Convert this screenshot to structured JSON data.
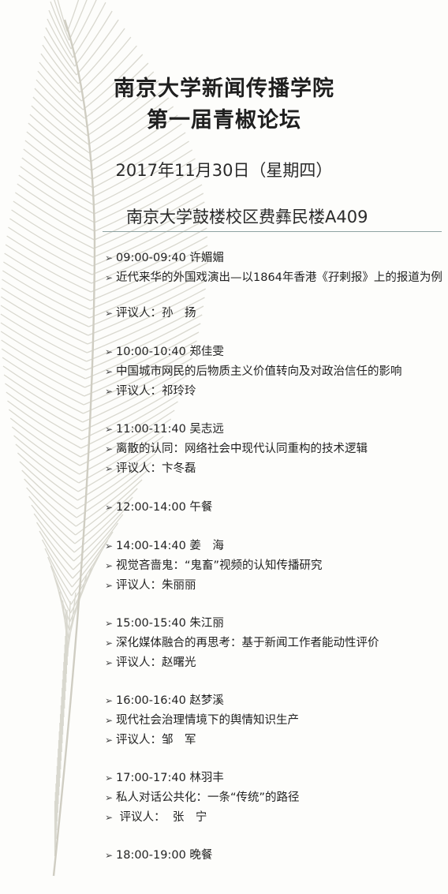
{
  "title": {
    "line1": "南京大学新闻传播学院",
    "line2": "第一届青椒论坛"
  },
  "date": "2017年11月30日（星期四）",
  "venue": "南京大学鼓楼校区费彝民楼A409",
  "bullet_icon": "arrow-bullet-icon",
  "schedule": [
    {
      "time_speaker": "09:00-09:40 许媚媚",
      "topic": "近代来华的外国戏演出—以1864年香港《孖剌报》上的报道为例",
      "reviewer": "评议人：孙　扬"
    },
    {
      "time_speaker": "10:00-10:40 郑佳雯",
      "topic": "中国城市网民的后物质主义价值转向及对政治信任的影响",
      "reviewer": "评议人：祁玲玲"
    },
    {
      "time_speaker": "11:00-11:40 吴志远",
      "topic": "离散的认同：网络社会中现代认同重构的技术逻辑",
      "reviewer": " 评议人：卞冬磊"
    },
    {
      "time_speaker": "12:00-14:00 午餐"
    },
    {
      "time_speaker": "14:00-14:40 姜　海",
      "topic": "视觉吝啬鬼：“鬼畜”视频的认知传播研究",
      "reviewer": "评议人：朱丽丽"
    },
    {
      "time_speaker": "15:00-15:40 朱江丽",
      "topic": "深化媒体融合的再思考：基于新闻工作者能动性评价",
      "reviewer": "评议人：赵曙光"
    },
    {
      "time_speaker": "16:00-16:40 赵梦溪",
      "topic": "现代社会治理情境下的舆情知识生产",
      "reviewer": "评议人：邹　军"
    },
    {
      "time_speaker": "17:00-17:40 林羽丰",
      "topic": "私人对话公共化：一条“传统”的路径",
      "reviewer": " 评议人：  张　宁"
    },
    {
      "time_speaker": "18:00-19:00 晚餐"
    }
  ]
}
